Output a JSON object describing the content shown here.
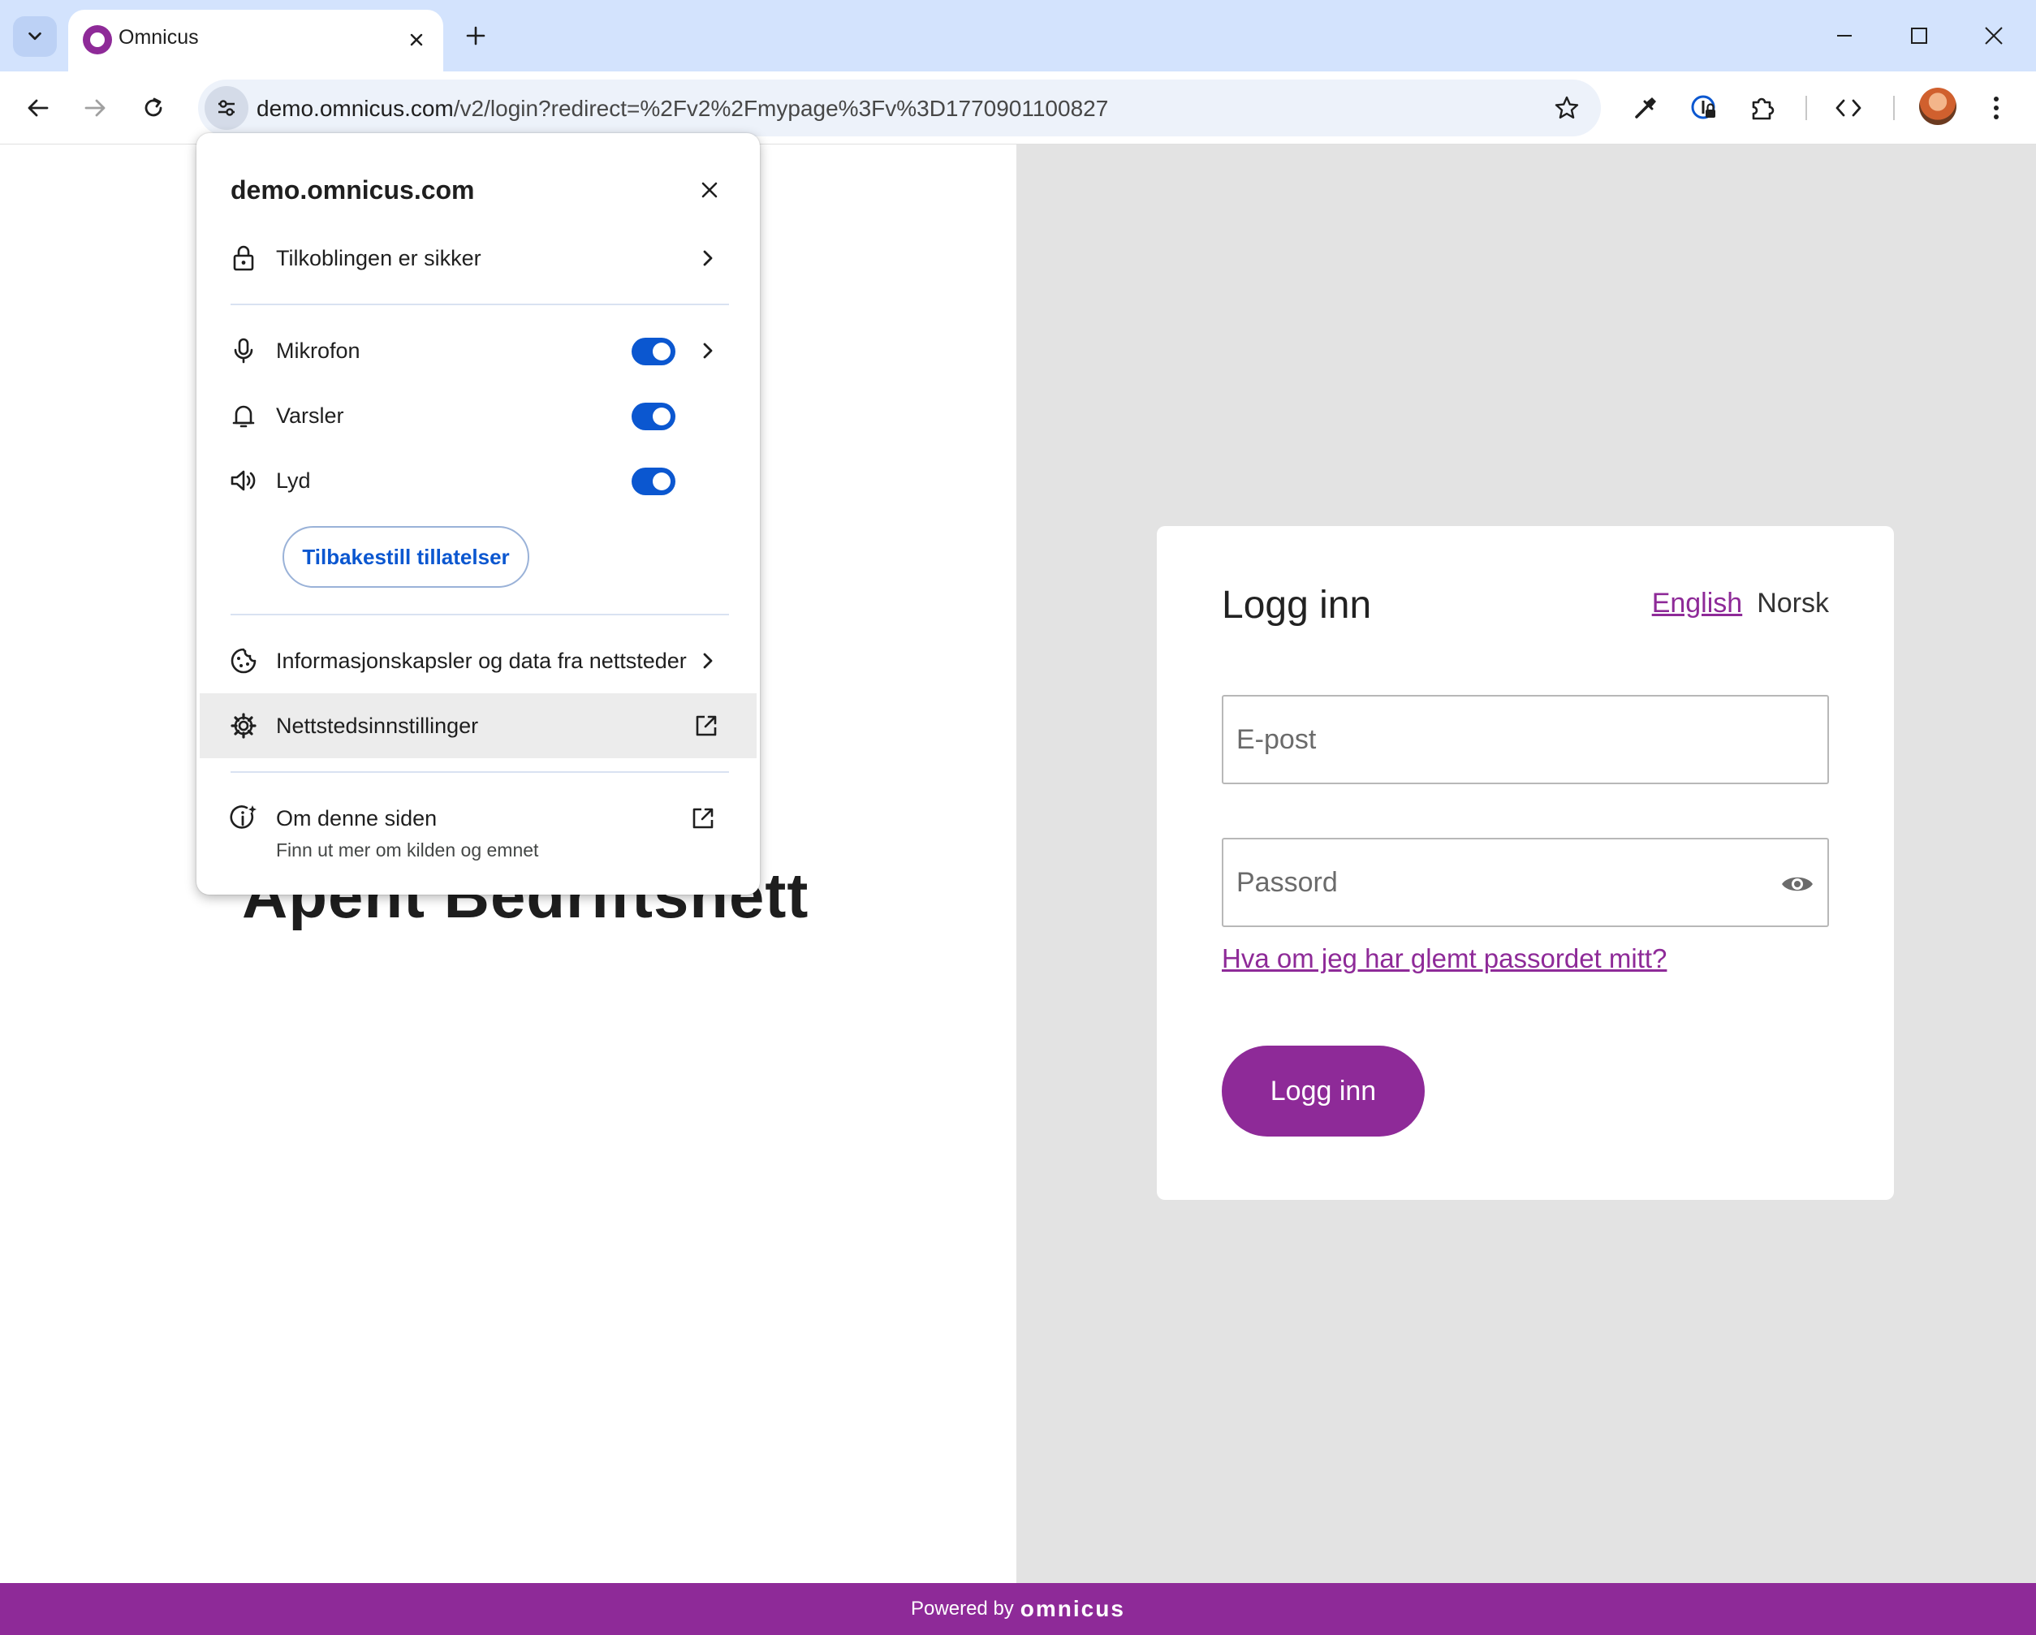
{
  "browser": {
    "tab": {
      "title": "Omnicus"
    },
    "address_bar": {
      "host": "demo.omnicus.com",
      "path": "/v2/login?redirect=%2Fv2%2Fmypage%3Fv%3D1770901100827"
    }
  },
  "site_info": {
    "domain": "demo.omnicus.com",
    "connection_label": "Tilkoblingen er sikker",
    "permissions": [
      {
        "label": "Mikrofon",
        "icon": "microphone-icon",
        "enabled": true
      },
      {
        "label": "Varsler",
        "icon": "bell-icon",
        "enabled": true
      },
      {
        "label": "Lyd",
        "icon": "speaker-icon",
        "enabled": true
      }
    ],
    "reset_button": "Tilbakestill tillatelser",
    "cookies_label": "Informasjonskapsler og data fra nettsteder",
    "site_settings_label": "Nettstedsinnstillinger",
    "about_label": "Om denne siden",
    "about_sub": "Finn ut mer om kilden og emnet"
  },
  "page": {
    "hero_title": "Åpent Bedriftsnett",
    "login": {
      "title": "Logg inn",
      "lang_english": "English",
      "lang_norsk": "Norsk",
      "email_placeholder": "E-post",
      "password_placeholder": "Passord",
      "forgot_link": "Hva om jeg har glemt passordet mitt?",
      "submit": "Logg inn"
    },
    "footer": {
      "powered_by": "Powered by",
      "brand": "omnicus"
    }
  },
  "colors": {
    "brand_purple": "#8e2a98",
    "toggle_blue": "#0b57d0",
    "tabstrip": "#d3e3fd"
  }
}
